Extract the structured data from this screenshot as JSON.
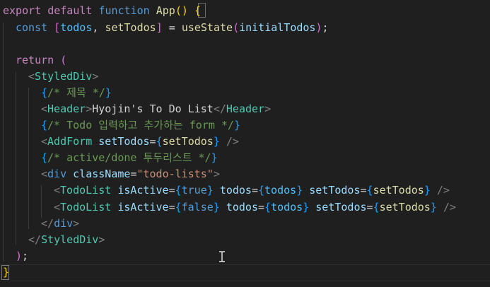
{
  "editor": {
    "lines": [
      {
        "tokens": [
          {
            "text": "export ",
            "cls": "kw"
          },
          {
            "text": "default ",
            "cls": "kw"
          },
          {
            "text": "function ",
            "cls": "kwb"
          },
          {
            "text": "App",
            "cls": "fn"
          },
          {
            "text": "() ",
            "cls": "br1"
          },
          {
            "text": "{",
            "cls": "br1"
          }
        ]
      },
      {
        "tokens": [
          {
            "text": "const ",
            "cls": "kwb"
          },
          {
            "text": "[",
            "cls": "br2"
          },
          {
            "text": "todos",
            "cls": "cst"
          },
          {
            "text": ", ",
            "cls": "txt"
          },
          {
            "text": "setTodos",
            "cls": "fn"
          },
          {
            "text": "]",
            "cls": "br2"
          },
          {
            "text": " = ",
            "cls": "txt"
          },
          {
            "text": "useState",
            "cls": "fn"
          },
          {
            "text": "(",
            "cls": "br2"
          },
          {
            "text": "initialTodos",
            "cls": "var"
          },
          {
            "text": ")",
            "cls": "br2"
          },
          {
            "text": ";",
            "cls": "txt"
          }
        ]
      },
      {
        "tokens": []
      },
      {
        "tokens": [
          {
            "text": "return ",
            "cls": "kw"
          },
          {
            "text": "(",
            "cls": "br2"
          }
        ]
      },
      {
        "tokens": [
          {
            "text": "<",
            "cls": "punc"
          },
          {
            "text": "StyledDiv",
            "cls": "tag"
          },
          {
            "text": ">",
            "cls": "punc"
          }
        ]
      },
      {
        "tokens": [
          {
            "text": "{",
            "cls": "br3"
          },
          {
            "text": "/* 제목 */",
            "cls": "cmt"
          },
          {
            "text": "}",
            "cls": "br3"
          }
        ]
      },
      {
        "tokens": [
          {
            "text": "<",
            "cls": "punc"
          },
          {
            "text": "Header",
            "cls": "tag"
          },
          {
            "text": ">",
            "cls": "punc"
          },
          {
            "text": "Hyojin's To Do List",
            "cls": "txt"
          },
          {
            "text": "</",
            "cls": "punc"
          },
          {
            "text": "Header",
            "cls": "tag"
          },
          {
            "text": ">",
            "cls": "punc"
          }
        ]
      },
      {
        "tokens": [
          {
            "text": "{",
            "cls": "br3"
          },
          {
            "text": "/* Todo 입력하고 추가하는 form */",
            "cls": "cmt"
          },
          {
            "text": "}",
            "cls": "br3"
          }
        ]
      },
      {
        "tokens": [
          {
            "text": "<",
            "cls": "punc"
          },
          {
            "text": "AddForm",
            "cls": "tag"
          },
          {
            "text": " ",
            "cls": "txt"
          },
          {
            "text": "setTodos",
            "cls": "attr"
          },
          {
            "text": "=",
            "cls": "txt"
          },
          {
            "text": "{",
            "cls": "br3"
          },
          {
            "text": "setTodos",
            "cls": "fn"
          },
          {
            "text": "}",
            "cls": "br3"
          },
          {
            "text": " />",
            "cls": "punc"
          }
        ]
      },
      {
        "tokens": [
          {
            "text": "{",
            "cls": "br3"
          },
          {
            "text": "/* active/done 투두리스트 */",
            "cls": "cmt"
          },
          {
            "text": "}",
            "cls": "br3"
          }
        ]
      },
      {
        "tokens": [
          {
            "text": "<",
            "cls": "punc"
          },
          {
            "text": "div",
            "cls": "tagh"
          },
          {
            "text": " ",
            "cls": "txt"
          },
          {
            "text": "className",
            "cls": "attr"
          },
          {
            "text": "=",
            "cls": "txt"
          },
          {
            "text": "\"todo-lists\"",
            "cls": "str"
          },
          {
            "text": ">",
            "cls": "punc"
          }
        ]
      },
      {
        "tokens": [
          {
            "text": "<",
            "cls": "punc"
          },
          {
            "text": "TodoList",
            "cls": "tag"
          },
          {
            "text": " ",
            "cls": "txt"
          },
          {
            "text": "isActive",
            "cls": "attr"
          },
          {
            "text": "=",
            "cls": "txt"
          },
          {
            "text": "{",
            "cls": "br3"
          },
          {
            "text": "true",
            "cls": "kwb"
          },
          {
            "text": "}",
            "cls": "br3"
          },
          {
            "text": " ",
            "cls": "txt"
          },
          {
            "text": "todos",
            "cls": "attr"
          },
          {
            "text": "=",
            "cls": "txt"
          },
          {
            "text": "{",
            "cls": "br3"
          },
          {
            "text": "todos",
            "cls": "cst"
          },
          {
            "text": "}",
            "cls": "br3"
          },
          {
            "text": " ",
            "cls": "txt"
          },
          {
            "text": "setTodos",
            "cls": "attr"
          },
          {
            "text": "=",
            "cls": "txt"
          },
          {
            "text": "{",
            "cls": "br3"
          },
          {
            "text": "setTodos",
            "cls": "fn"
          },
          {
            "text": "}",
            "cls": "br3"
          },
          {
            "text": " />",
            "cls": "punc"
          }
        ]
      },
      {
        "tokens": [
          {
            "text": "<",
            "cls": "punc"
          },
          {
            "text": "TodoList",
            "cls": "tag"
          },
          {
            "text": " ",
            "cls": "txt"
          },
          {
            "text": "isActive",
            "cls": "attr"
          },
          {
            "text": "=",
            "cls": "txt"
          },
          {
            "text": "{",
            "cls": "br3"
          },
          {
            "text": "false",
            "cls": "kwb"
          },
          {
            "text": "}",
            "cls": "br3"
          },
          {
            "text": " ",
            "cls": "txt"
          },
          {
            "text": "todos",
            "cls": "attr"
          },
          {
            "text": "=",
            "cls": "txt"
          },
          {
            "text": "{",
            "cls": "br3"
          },
          {
            "text": "todos",
            "cls": "cst"
          },
          {
            "text": "}",
            "cls": "br3"
          },
          {
            "text": " ",
            "cls": "txt"
          },
          {
            "text": "setTodos",
            "cls": "attr"
          },
          {
            "text": "=",
            "cls": "txt"
          },
          {
            "text": "{",
            "cls": "br3"
          },
          {
            "text": "setTodos",
            "cls": "fn"
          },
          {
            "text": "}",
            "cls": "br3"
          },
          {
            "text": " />",
            "cls": "punc"
          }
        ]
      },
      {
        "tokens": [
          {
            "text": "</",
            "cls": "punc"
          },
          {
            "text": "div",
            "cls": "tagh"
          },
          {
            "text": ">",
            "cls": "punc"
          }
        ]
      },
      {
        "tokens": [
          {
            "text": "</",
            "cls": "punc"
          },
          {
            "text": "StyledDiv",
            "cls": "tag"
          },
          {
            "text": ">",
            "cls": "punc"
          }
        ]
      },
      {
        "tokens": [
          {
            "text": ")",
            "cls": "br2"
          },
          {
            "text": ";",
            "cls": "txt"
          }
        ]
      },
      {
        "tokens": [
          {
            "text": "}",
            "cls": "br1"
          }
        ]
      }
    ]
  },
  "colors": {
    "background": "#1f1f1f",
    "keyword": "#c586c0",
    "storage": "#569cd6",
    "function": "#dcdcaa",
    "component_tag": "#4ec9b0",
    "attribute": "#9cdcfe",
    "string": "#ce9178",
    "comment": "#6a9955",
    "bracket_level1": "#ffd700",
    "bracket_level2": "#da70d6",
    "bracket_level3": "#179fff"
  },
  "cursor": {
    "icon": "text-cursor-icon"
  }
}
